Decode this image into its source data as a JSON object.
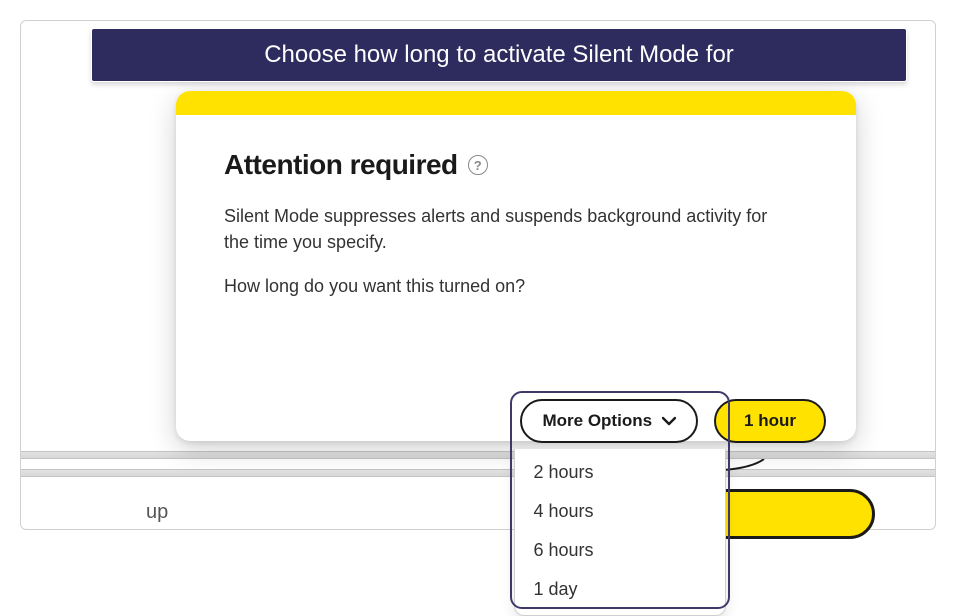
{
  "banner": {
    "title": "Choose how long to activate Silent Mode for"
  },
  "dialog": {
    "heading": "Attention required",
    "help_tooltip": "?",
    "description_line1": "Silent Mode suppresses alerts and suspends background activity for the time you specify.",
    "description_line2": "How long do you want this turned on?",
    "more_options_label": "More Options",
    "primary_button_label": "1 hour",
    "options": [
      "2 hours",
      "4 hours",
      "6 hours",
      "1 day"
    ]
  },
  "background": {
    "partial_text": "up"
  },
  "colors": {
    "accent_yellow": "#ffe200",
    "banner_bg": "#2e2b5f"
  }
}
